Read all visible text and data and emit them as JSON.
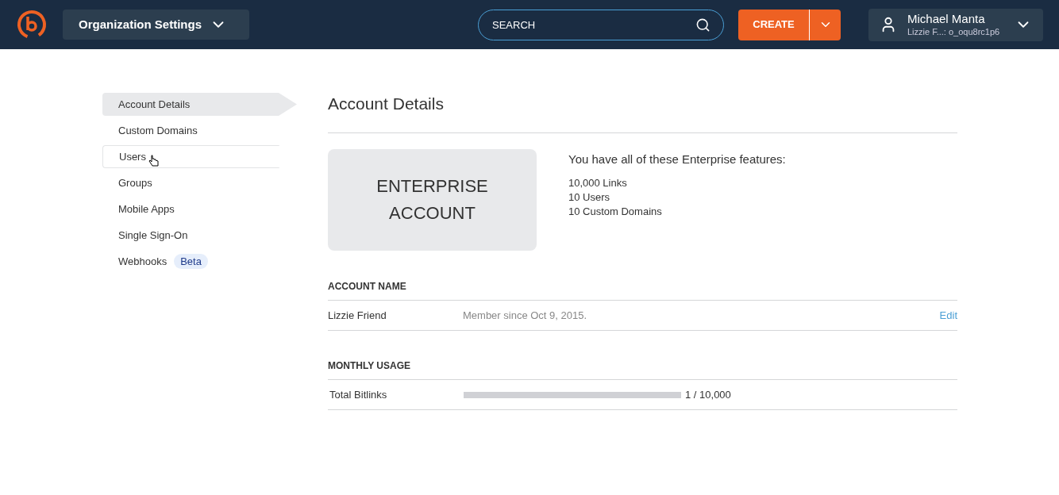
{
  "header": {
    "org_menu": "Organization Settings",
    "search": {
      "placeholder": "SEARCH"
    },
    "create_button": "CREATE",
    "user": {
      "name": "Michael Manta",
      "account": "Lizzie F...: o_oqu8rc1p6"
    }
  },
  "sidebar": {
    "items": [
      {
        "label": "Account Details",
        "selected": true,
        "hovered": false
      },
      {
        "label": "Custom Domains",
        "selected": false,
        "hovered": false
      },
      {
        "label": "Users",
        "selected": false,
        "hovered": true
      },
      {
        "label": "Groups",
        "selected": false,
        "hovered": false
      },
      {
        "label": "Mobile Apps",
        "selected": false,
        "hovered": false
      },
      {
        "label": "Single Sign-On",
        "selected": false,
        "hovered": false
      },
      {
        "label": "Webhooks",
        "selected": false,
        "hovered": false,
        "badge": "Beta"
      }
    ]
  },
  "main": {
    "title": "Account Details",
    "plan_card": [
      "ENTERPRISE",
      "ACCOUNT"
    ],
    "features_heading": "You have all of these Enterprise features:",
    "features": [
      "10,000 Links",
      "10 Users",
      "10 Custom Domains"
    ],
    "account_name": {
      "heading": "ACCOUNT NAME",
      "name": "Lizzie Friend",
      "member_since": "Member since Oct 9, 2015.",
      "edit": "Edit"
    },
    "monthly_usage": {
      "heading": "MONTHLY USAGE",
      "label": "Total Bitlinks",
      "level": 0.0001,
      "reading": "1 / 10,000"
    }
  }
}
